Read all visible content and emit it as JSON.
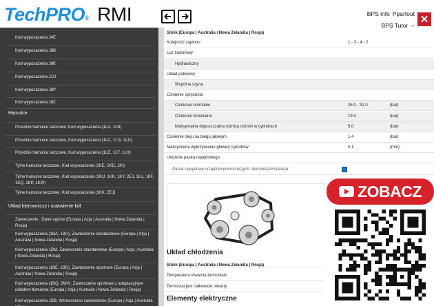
{
  "header": {
    "logo_tech": "Tech",
    "logo_pro": "PRO",
    "logo_reg": "®",
    "logo_rmi": "RMI",
    "links": [
      "BPS info",
      "Ppartout"
    ],
    "links2": [
      "BPS Tutor",
      "--"
    ]
  },
  "sidebar": {
    "items": [
      {
        "label": "Kod wyposażenia J4E",
        "type": "sub"
      },
      {
        "label": "Kod wyposażenia J8B",
        "type": "sub"
      },
      {
        "label": "Kod wyposażenia J8K",
        "type": "sub"
      },
      {
        "label": "Kod wyposażenia J1U",
        "type": "sub"
      },
      {
        "label": "Kod wyposażenia J8P",
        "type": "sub"
      },
      {
        "label": "Kod wyposażenia J8Z",
        "type": "sub"
      },
      {
        "label": "Hamulce",
        "type": "cat"
      },
      {
        "label": "Przednie hamulce tarczowe, Kod wyposażenia (1LA, 1LB)",
        "type": "sub"
      },
      {
        "label": "Przednie hamulce tarczowe, Kod wyposażenia (1LC, 1LG, 1LD)",
        "type": "sub"
      },
      {
        "label": "Przednie hamulce tarczowe, Kod wyposażenia (1LE, 1LF, 1LH)",
        "type": "sub"
      },
      {
        "label": "Tylne hamulce tarczowe, Kod wyposażenia (1KE, 1KD, 1KI)",
        "type": "sub"
      },
      {
        "label": "Tylne hamulce tarczowe, Kod wyposażenia (1KU, 1KK, 1KY, 2EJ, 1KJ, 1KF, 1KQ, 1KP, 1KW)",
        "type": "sub"
      },
      {
        "label": "Tylne hamulce tarczowe, Kod wyposażenia (1KK, 2EJ)",
        "type": "sub"
      },
      {
        "label": "Układ kierowniczy i ustawienie kół",
        "type": "cat"
      },
      {
        "label": "Zawieszenie : Dane ogólne (Europa | Azja | Australia | Nowa Zelandia | Rosja)",
        "type": "sub"
      },
      {
        "label": "Kod wyposażenia (1BA, 1BU), Zawieszenie standardowe (Europa | Azja | Australia | Nowa Zelandia | Rosja)",
        "type": "sub"
      },
      {
        "label": "Kod wyposażenia 1BM, Zawieszenie standardowe (Europa | Azja | Australia | Nowa Zelandia | Rosja)",
        "type": "sub"
      },
      {
        "label": "Kod wyposażenia (1BE, 1BD), Zawieszenie sportowe (Europa | Azja | Australia | Nowa Zelandia | Rosja)",
        "type": "sub"
      },
      {
        "label": "Kod wyposażenia (1BQ, 2MV), Zawieszenie sportowe z adaptacyjnym układem tłumienia (Europa | Azja | Australia | Nowa Zelandia | Rosja)",
        "type": "sub"
      },
      {
        "label": "Kod wyposażenia 1BB, Wzmocnione zawieszenie (Europa | Azja | Australia | Nowa",
        "type": "sub"
      }
    ]
  },
  "main": {
    "rows": [
      {
        "label": "Silnik (Europa | Australia i Nowa Zelandia | Rosja)",
        "value": "",
        "unit": "",
        "indent": 0,
        "bold": true,
        "shade": false
      },
      {
        "label": "Kolejność zapłonu",
        "value": "1 - 3 - 4 - 2",
        "unit": "",
        "indent": 0,
        "bold": false,
        "shade": false
      },
      {
        "label": "Luz zaworowy",
        "value": "",
        "unit": "",
        "indent": 0,
        "bold": false,
        "shade": false
      },
      {
        "label": "Hydrauliczny",
        "value": "",
        "unit": "",
        "indent": 1,
        "bold": false,
        "shade": true
      },
      {
        "label": "Układ paliwowy",
        "value": "",
        "unit": "",
        "indent": 0,
        "bold": false,
        "shade": false
      },
      {
        "label": "Wspólna szyna",
        "value": "",
        "unit": "",
        "indent": 1,
        "bold": false,
        "shade": true
      },
      {
        "label": "Ciśnienie sprężania",
        "value": "",
        "unit": "",
        "indent": 0,
        "bold": false,
        "shade": false
      },
      {
        "label": "Ciśnienie normalne",
        "value": "25.0 - 31.0",
        "unit": "(bar)",
        "indent": 1,
        "bold": false,
        "shade": true
      },
      {
        "label": "Ciśnienie minimalne",
        "value": "19.0",
        "unit": "(bar)",
        "indent": 1,
        "bold": false,
        "shade": true
      },
      {
        "label": "Maksymalna dopuszczalna różnica ciśnień w cylindrach",
        "value": "5.0",
        "unit": "(bar)",
        "indent": 1,
        "bold": false,
        "shade": true
      },
      {
        "label": "Ciśnienie oleju na biegu jałowym",
        "value": "1.4",
        "unit": "(bar)",
        "indent": 0,
        "bold": false,
        "shade": false
      },
      {
        "label": "Maksymalne wykrzywienie głowicy cylindrów",
        "value": "0.1",
        "unit": "(mm)",
        "indent": 0,
        "bold": false,
        "shade": false
      },
      {
        "label": "Ułożenie paska napędowego",
        "value": "",
        "unit": "",
        "indent": 0,
        "bold": false,
        "shade": false
      }
    ],
    "belt_note": "Pasek napędowy urządzeń pomocniczych: demontaż/instalacja",
    "cooling": {
      "title": "Układ chłodzenia",
      "rows": [
        {
          "label": "Silnik (Europa | Australia i Nowa Zelandia | Rosja)"
        },
        {
          "label": "Temperatura otwarcia termostatu"
        },
        {
          "label": "Termostat jest całkowicie otwarty"
        }
      ]
    },
    "electrical_title": "Elementy elektryczne"
  },
  "promo": {
    "label": "ZOBACZ",
    "brand_color": "#d6222a"
  }
}
